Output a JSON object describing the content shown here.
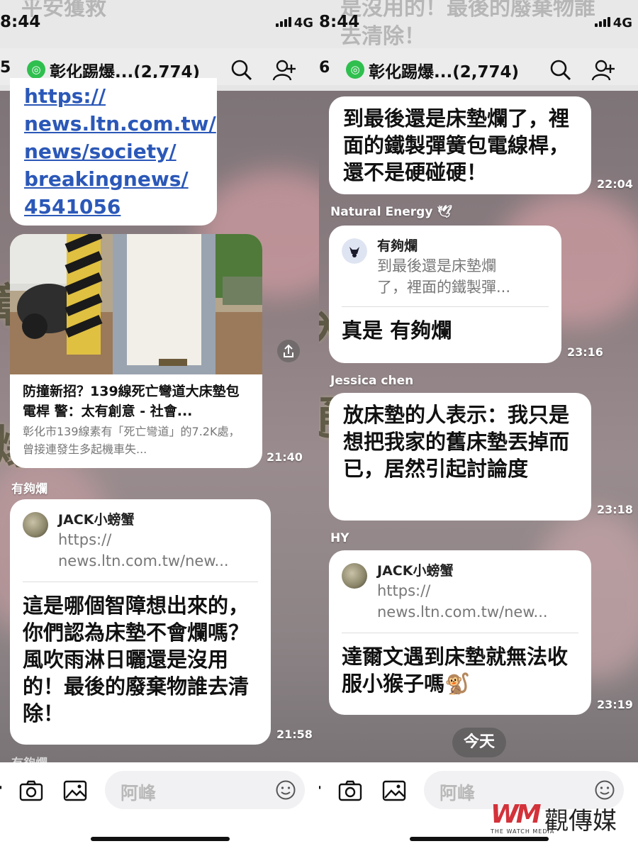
{
  "left": {
    "status": {
      "time": "8:44",
      "network": "4G",
      "ghost": "平安獲救"
    },
    "header": {
      "back_count": "5",
      "group_icon": "group-icon",
      "group_name": "彰化踢爆...(2,774)"
    },
    "link_bubble": {
      "link_lines": [
        "https://",
        "news.ltn.com.tw/",
        "news/society/",
        "breakingnews/",
        "4541056"
      ]
    },
    "preview_card": {
      "title": "防撞新招？139線死亡彎道大床墊包電桿 警：太有創意 - 社會...",
      "desc": "彰化市139線素有「死亡彎道」的7.2K處，曾接連發生多起機車失...",
      "time": "21:40"
    },
    "msg2": {
      "sender": "有夠爛",
      "reply_name": "JACK小螃蟹",
      "reply_snippet": [
        "https://",
        "news.ltn.com.tw/new..."
      ],
      "text": "這是哪個智障想出來的，你們認為床墊不會爛嗎？風吹雨淋日曬還是沒用的！最後的廢棄物誰去清除！",
      "time": "21:58"
    },
    "next_sender": "有夠爛",
    "input": {
      "placeholder": "阿峰"
    }
  },
  "right": {
    "status": {
      "time": "8:44",
      "network": "4G",
      "ghost": "是沒用的！最後的廢棄物誰去清除！"
    },
    "header": {
      "back_count": "6",
      "group_icon": "group-icon",
      "group_name": "彰化踢爆...(2,774)"
    },
    "msg1": {
      "text": "到最後還是床墊爛了，裡面的鐵製彈簧包電線桿，還不是硬碰硬！",
      "time": "22:04"
    },
    "msg2": {
      "sender": "Natural Energy 🕊",
      "reply_name": "有夠爛",
      "reply_snippet": [
        "到最後還是床墊爛",
        "了，裡面的鐵製彈..."
      ],
      "text": "真是 有夠爛",
      "time": "23:16"
    },
    "msg3": {
      "sender": "Jessica chen",
      "text": "放床墊的人表示：我只是想把我家的舊床墊丟掉而已，居然引起討論度",
      "time": "23:18"
    },
    "msg4": {
      "sender": "HY",
      "reply_name": "JACK小螃蟹",
      "reply_snippet": [
        "https://",
        "news.ltn.com.tw/new..."
      ],
      "text": "達爾文遇到床墊就無法收服小猴子嗎🐒",
      "time": "23:19"
    },
    "today": "今天",
    "input": {
      "placeholder": "阿峰"
    }
  },
  "watermark": {
    "logo": "WM",
    "brand": "觀傳媒",
    "sub": "THE WATCH MEDIA"
  },
  "colors": {
    "link": "#2b58b8",
    "group_green": "#2fbf4f",
    "watermark_red": "#d3323a"
  }
}
